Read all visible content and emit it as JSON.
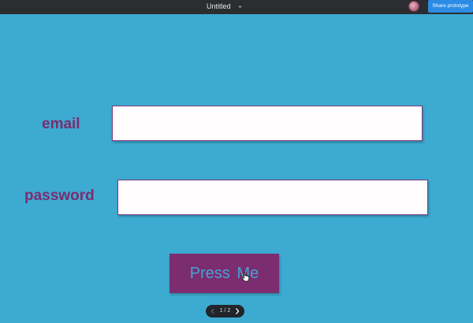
{
  "topbar": {
    "doc_title": "Untitled",
    "title_icon": "chevron-down-icon",
    "avatar_icon": "avatar",
    "share_label": "Share prototype"
  },
  "form": {
    "email_label": "email",
    "email_value": "",
    "password_label": "password",
    "password_value": "",
    "button_label": "Press  Me"
  },
  "pager": {
    "current_page": "1",
    "total_pages": "2",
    "label": "1 / 2",
    "prev_icon": "chevron-left-icon",
    "next_icon": "chevron-right-icon"
  },
  "colors": {
    "canvas_background": "#3daad2",
    "topbar_background": "#2b2d31",
    "label_color": "#7b2d6f",
    "button_background": "#7b2d6f",
    "button_text": "#46a3d3",
    "share_button": "#2b8ce6"
  }
}
